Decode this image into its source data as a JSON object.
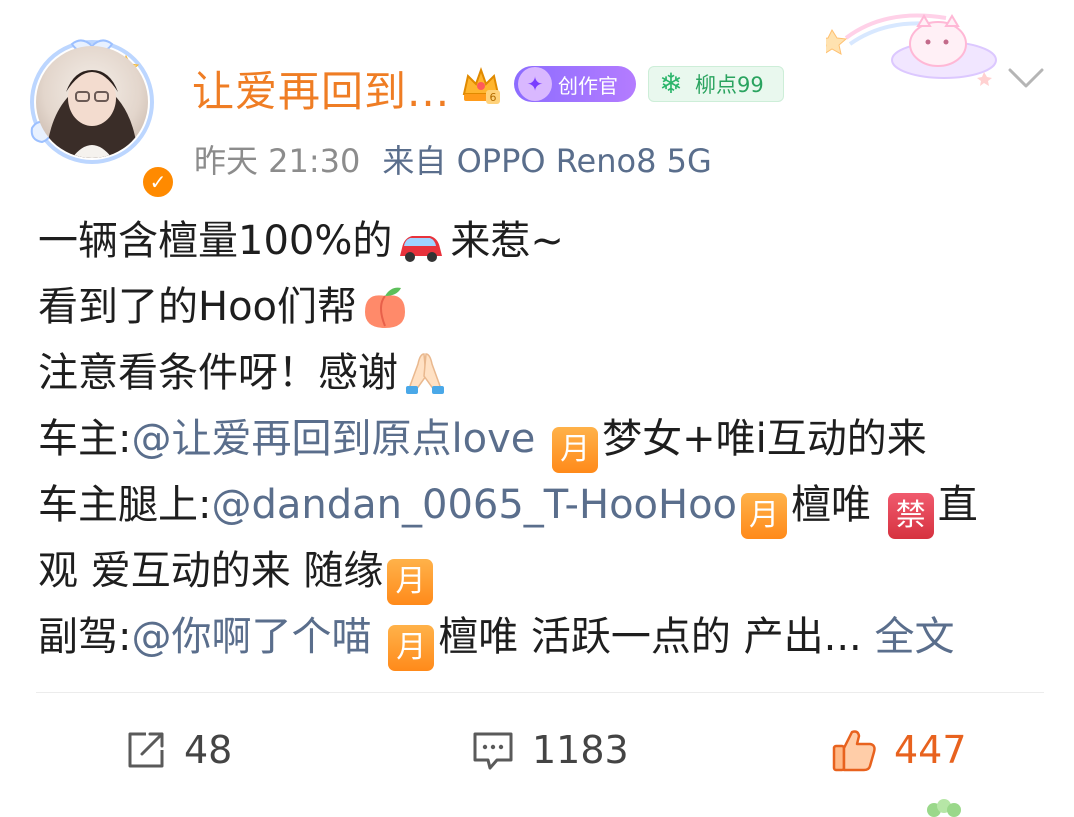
{
  "header": {
    "username": "让爱再回到...",
    "creator_badge": "创作官",
    "fan_badge": "柳点99",
    "time": "昨天 21:30",
    "source": "来自 OPPO Reno8 5G"
  },
  "post": {
    "l1": {
      "a": "一辆含檀量100%的",
      "b": "来惹~"
    },
    "l2": {
      "a": "看到了的Hoo们帮"
    },
    "l3": {
      "a": "注意看条件呀！感谢"
    },
    "l4": {
      "label": "车主:",
      "mention": "@让爱再回到原点love",
      "rest": "梦女+唯i互动的来"
    },
    "l5": {
      "label": "车主腿上:",
      "mention": "@dandan_0065_T-HooHoo",
      "rest1": "檀唯",
      "rest2": "直"
    },
    "l6": {
      "a": "观 爱互动的来 随缘"
    },
    "l7": {
      "label": "副驾:",
      "mention": "@你啊了个喵",
      "rest": "檀唯 活跃一点的 产出...",
      "more": "全文"
    }
  },
  "emoji": {
    "moon": "月",
    "ban": "禁"
  },
  "footer": {
    "shares": "48",
    "comments": "1183",
    "likes": "447"
  },
  "colors": {
    "username": "#ef7d24",
    "link": "#5a6e8c",
    "meta": "#8c8c8c",
    "like": "#e8621e"
  },
  "icons": [
    "verified-icon",
    "crown-badge-icon",
    "creator-badge-icon",
    "fan-snowflake-icon",
    "chevron-down-icon",
    "car-emoji",
    "peach-emoji",
    "pray-emoji",
    "share-icon",
    "comment-icon",
    "like-icon"
  ]
}
